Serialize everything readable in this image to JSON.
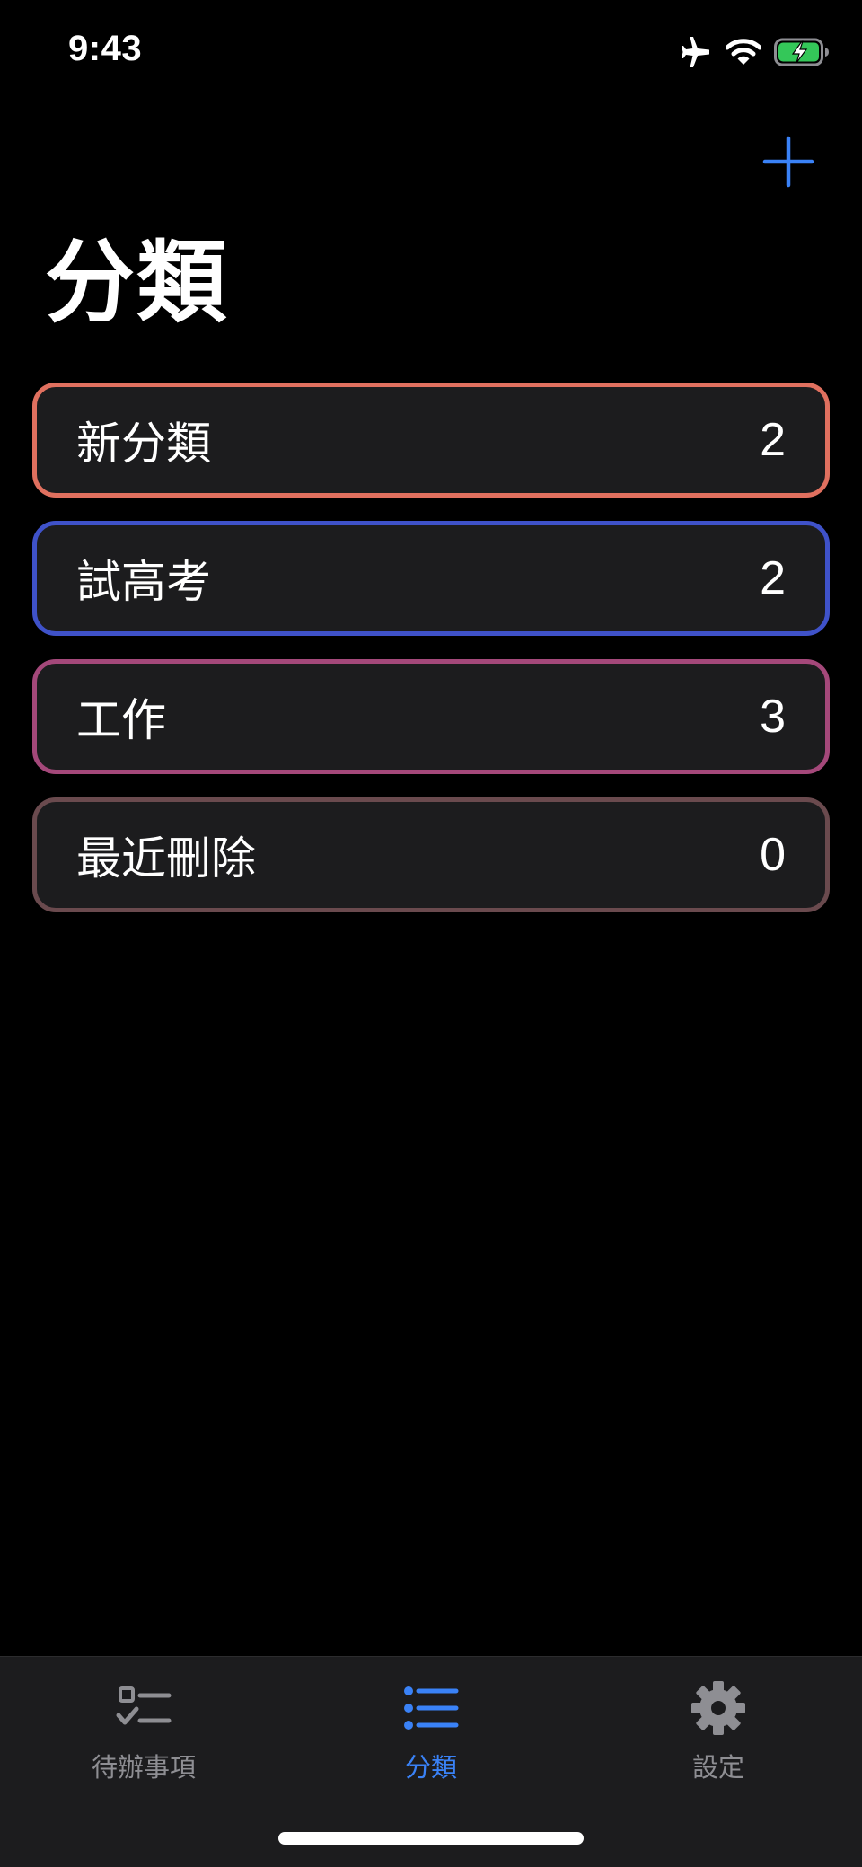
{
  "status_bar": {
    "time": "9:43",
    "icons": [
      "airplane-icon",
      "wifi-icon",
      "battery-charging-icon"
    ],
    "battery_color": "#34c759"
  },
  "nav": {
    "add_icon": "plus-icon",
    "accent_color": "#3a82f7"
  },
  "page_title": "分類",
  "categories": [
    {
      "name": "新分類",
      "count": "2",
      "border_color": "#e0705f"
    },
    {
      "name": "試高考",
      "count": "2",
      "border_color": "#3f52c9"
    },
    {
      "name": "工作",
      "count": "3",
      "border_color": "#a4487a"
    },
    {
      "name": "最近刪除",
      "count": "0",
      "border_color": "#6a4a4e"
    }
  ],
  "tab_bar": {
    "tabs": [
      {
        "label": "待辦事項",
        "icon": "checklist-icon",
        "active": false
      },
      {
        "label": "分類",
        "icon": "list-icon",
        "active": true
      },
      {
        "label": "設定",
        "icon": "gear-icon",
        "active": false
      }
    ],
    "active_color": "#3a82f7",
    "inactive_color": "#8e8e93"
  }
}
